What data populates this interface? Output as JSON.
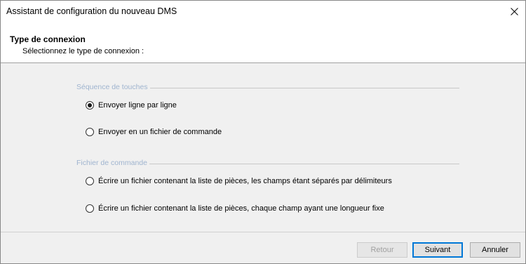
{
  "window": {
    "title": "Assistant de configuration du nouveau DMS",
    "close_icon": "close-icon"
  },
  "header": {
    "title": "Type de connexion",
    "subtitle": "Sélectionnez le type de connexion :"
  },
  "groups": [
    {
      "label": "Séquence de touches",
      "options": [
        {
          "label": "Envoyer ligne par ligne",
          "checked": true
        },
        {
          "label": "Envoyer en un fichier de commande",
          "checked": false
        }
      ]
    },
    {
      "label": "Fichier de commande",
      "options": [
        {
          "label": "Écrire un fichier contenant la liste de pièces, les champs étant séparés par délimiteurs",
          "checked": false
        },
        {
          "label": "Écrire un fichier contenant la liste de pièces, chaque champ ayant une longueur fixe",
          "checked": false
        }
      ]
    }
  ],
  "footer": {
    "back_label": "Retour",
    "back_enabled": false,
    "next_label": "Suivant",
    "cancel_label": "Annuler"
  },
  "colors": {
    "accent": "#0078d7",
    "group_label": "#9fb4cf",
    "panel_bg": "#f0f0f0"
  }
}
